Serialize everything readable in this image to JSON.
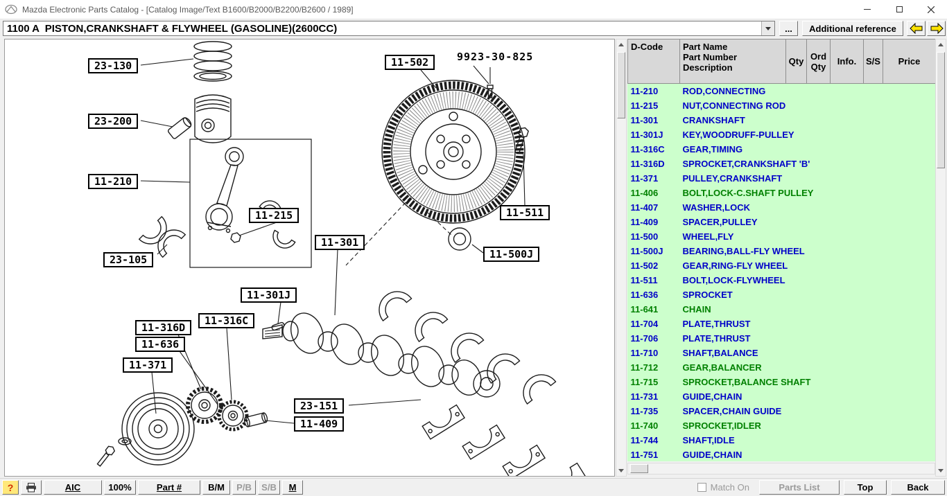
{
  "window": {
    "title": "Mazda Electronic Parts Catalog - [Catalog Image/Text B1600/B2000/B2200/B2600 / 1989]"
  },
  "toolbar": {
    "section_select_value": "1100 A  PISTON,CRANKSHAFT & FLYWHEEL (GASOLINE)(2600CC)",
    "more_label": "...",
    "additional_reference_label": "Additional reference"
  },
  "diagram": {
    "callouts": [
      {
        "label": "23-130"
      },
      {
        "label": "23-200"
      },
      {
        "label": "11-210"
      },
      {
        "label": "23-105"
      },
      {
        "label": "11-215"
      },
      {
        "label": "11-301"
      },
      {
        "label": "11-301J"
      },
      {
        "label": "11-316C"
      },
      {
        "label": "11-316D"
      },
      {
        "label": "11-636"
      },
      {
        "label": "11-371"
      },
      {
        "label": "23-151"
      },
      {
        "label": "11-409"
      },
      {
        "label": "11-502"
      },
      {
        "label": "9923-30-825",
        "style": "plain"
      },
      {
        "label": "11-511"
      },
      {
        "label": "11-500J"
      }
    ]
  },
  "table": {
    "headers": {
      "dcode": "D-Code",
      "part": [
        "Part Name",
        "Part Number",
        "Description"
      ],
      "qty": "Qty",
      "ord_qty": [
        "Ord",
        "Qty"
      ],
      "info": "Info.",
      "ss": "S/S",
      "price": "Price"
    },
    "rows": [
      {
        "dcode": "11-210",
        "name": "ROD,CONNECTING",
        "color": "blue"
      },
      {
        "dcode": "11-215",
        "name": "NUT,CONNECTING ROD",
        "color": "blue"
      },
      {
        "dcode": "11-301",
        "name": "CRANKSHAFT",
        "color": "blue"
      },
      {
        "dcode": "11-301J",
        "name": "KEY,WOODRUFF-PULLEY",
        "color": "blue"
      },
      {
        "dcode": "11-316C",
        "name": "GEAR,TIMING",
        "color": "blue"
      },
      {
        "dcode": "11-316D",
        "name": "SPROCKET,CRANKSHAFT 'B'",
        "color": "blue"
      },
      {
        "dcode": "11-371",
        "name": "PULLEY,CRANKSHAFT",
        "color": "blue"
      },
      {
        "dcode": "11-406",
        "name": "BOLT,LOCK-C.SHAFT PULLEY",
        "color": "green"
      },
      {
        "dcode": "11-407",
        "name": "WASHER,LOCK",
        "color": "blue"
      },
      {
        "dcode": "11-409",
        "name": "SPACER,PULLEY",
        "color": "blue"
      },
      {
        "dcode": "11-500",
        "name": "WHEEL,FLY",
        "color": "blue"
      },
      {
        "dcode": "11-500J",
        "name": "BEARING,BALL-FLY WHEEL",
        "color": "blue"
      },
      {
        "dcode": "11-502",
        "name": "GEAR,RING-FLY WHEEL",
        "color": "blue"
      },
      {
        "dcode": "11-511",
        "name": "BOLT,LOCK-FLYWHEEL",
        "color": "blue"
      },
      {
        "dcode": "11-636",
        "name": "SPROCKET",
        "color": "blue"
      },
      {
        "dcode": "11-641",
        "name": "CHAIN",
        "color": "green"
      },
      {
        "dcode": "11-704",
        "name": "PLATE,THRUST",
        "color": "blue"
      },
      {
        "dcode": "11-706",
        "name": "PLATE,THRUST",
        "color": "blue"
      },
      {
        "dcode": "11-710",
        "name": "SHAFT,BALANCE",
        "color": "blue"
      },
      {
        "dcode": "11-712",
        "name": "GEAR,BALANCER",
        "color": "green"
      },
      {
        "dcode": "11-715",
        "name": "SPROCKET,BALANCE SHAFT",
        "color": "green"
      },
      {
        "dcode": "11-731",
        "name": "GUIDE,CHAIN",
        "color": "blue"
      },
      {
        "dcode": "11-735",
        "name": "SPACER,CHAIN GUIDE",
        "color": "blue"
      },
      {
        "dcode": "11-740",
        "name": "SPROCKET,IDLER",
        "color": "green"
      },
      {
        "dcode": "11-744",
        "name": "SHAFT,IDLE",
        "color": "blue"
      },
      {
        "dcode": "11-751",
        "name": "GUIDE,CHAIN",
        "color": "blue"
      }
    ]
  },
  "statusbar": {
    "help_label": "?",
    "aic_label": "AIC",
    "zoom_label": "100%",
    "part_label": "Part #",
    "bm_label": "B/M",
    "pb_label": "P/B",
    "sb_label": "S/B",
    "m_label": "M",
    "match_on_label": "Match On",
    "parts_list_label": "Parts List",
    "top_label": "Top",
    "back_label": "Back"
  },
  "colors": {
    "row_blue": "#0000C8",
    "row_green": "#008000",
    "table_bg": "#CCFFCC",
    "header_bg": "#D8D8D8",
    "nav_arrow": "#FFE400"
  }
}
